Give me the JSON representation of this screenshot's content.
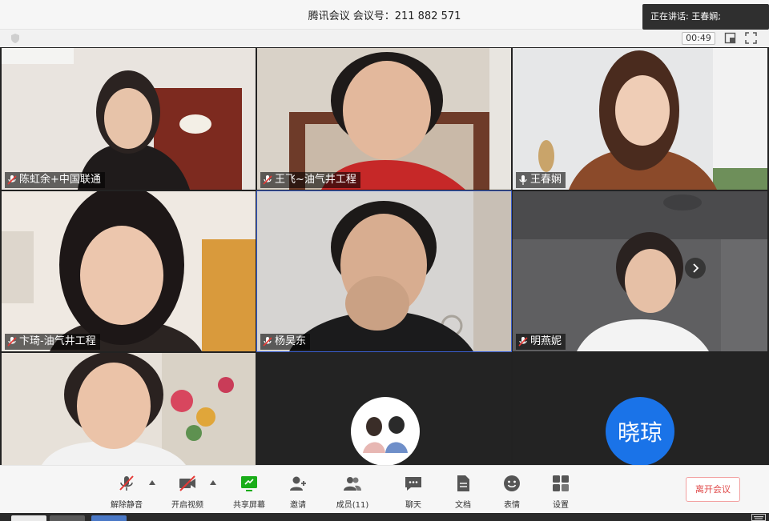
{
  "window": {
    "title": "腾讯会议 会议号：211 882 571",
    "speaking_toast": "正在讲话: 王春娴;"
  },
  "infobar": {
    "timer": "00:49",
    "icons": [
      "shield-icon",
      "layout-icon",
      "fullscreen-icon"
    ]
  },
  "participants": [
    {
      "name": "陈虹余+中国联通",
      "mic": "muted"
    },
    {
      "name": "王飞~油气井工程",
      "mic": "muted"
    },
    {
      "name": "王春娴",
      "mic": "active"
    },
    {
      "name": "卞琦-油气井工程",
      "mic": "muted"
    },
    {
      "name": "杨昊东",
      "mic": "muted"
    },
    {
      "name": "明燕妮",
      "mic": "muted"
    },
    {
      "name": "",
      "mic": "none"
    },
    {
      "name": "",
      "mic": "none"
    },
    {
      "name": "晓琼",
      "avatar_text": "晓琼",
      "avatar_color": "#1a73e8"
    }
  ],
  "toolbar": {
    "unmute": "解除静音",
    "start_video": "开启视频",
    "share_screen": "共享屏幕",
    "invite": "邀请",
    "members": "成员(11)",
    "chat": "聊天",
    "docs": "文档",
    "emoji": "表情",
    "settings": "设置",
    "leave": "离开会议"
  },
  "colors": {
    "accent_green": "#1aad19",
    "leave_red": "#e04a4a",
    "mute_red": "#e53935",
    "avatar_blue": "#1a73e8"
  }
}
